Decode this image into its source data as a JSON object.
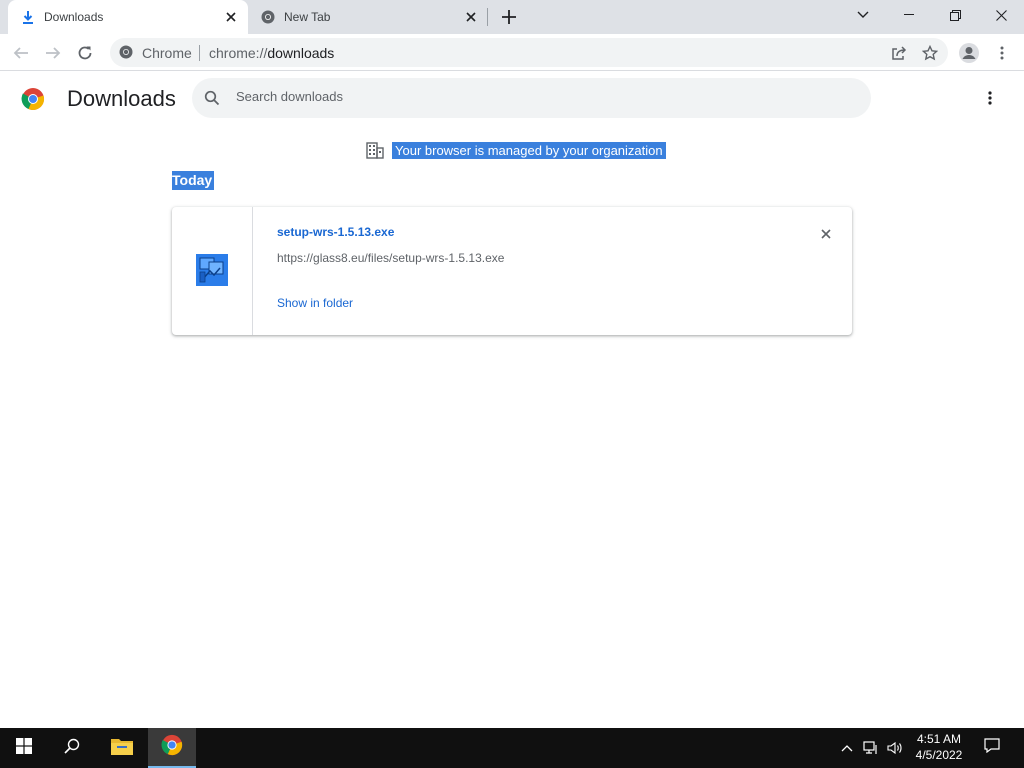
{
  "tabs": [
    {
      "label": "Downloads",
      "active": true,
      "icon": "download-icon"
    },
    {
      "label": "New Tab",
      "active": false,
      "icon": "chrome-icon"
    }
  ],
  "omnibox": {
    "chip": "Chrome",
    "url_scheme": "chrome://",
    "url_host": "downloads"
  },
  "page": {
    "title": "Downloads",
    "search_placeholder": "Search downloads"
  },
  "managed_notice": "Your browser is managed by your organization",
  "date_group": "Today",
  "download": {
    "file_name": "setup-wrs-1.5.13.exe",
    "url": "https://glass8.eu/files/setup-wrs-1.5.13.exe",
    "action": "Show in folder"
  },
  "taskbar": {
    "time": "4:51 AM",
    "date": "4/5/2022"
  },
  "colors": {
    "accent": "#1967d2",
    "tabstrip": "#dee1e6",
    "selection": "#3a80dd",
    "taskbar": "#101010"
  }
}
